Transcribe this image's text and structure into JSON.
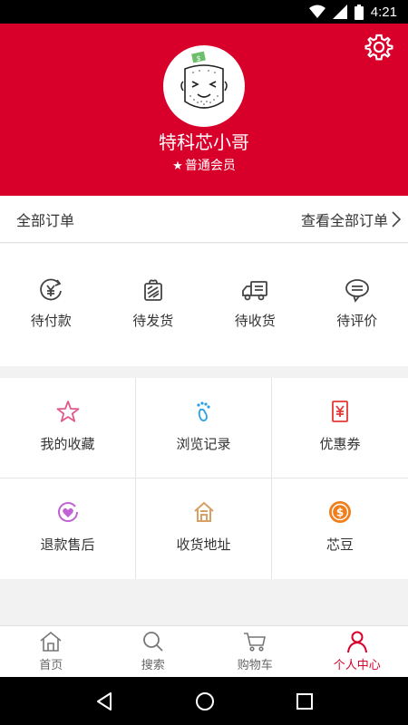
{
  "status_bar": {
    "time": "4:21"
  },
  "profile": {
    "username": "特科芯小哥",
    "member_star": "★",
    "member_level": "普通会员",
    "avatar_badge_text": "$"
  },
  "orders": {
    "title": "全部订单",
    "view_all": "查看全部订单"
  },
  "order_status": [
    {
      "label": "待付款",
      "icon": "yen-refresh-icon"
    },
    {
      "label": "待发货",
      "icon": "package-icon"
    },
    {
      "label": "待收货",
      "icon": "truck-icon"
    },
    {
      "label": "待评价",
      "icon": "comment-icon"
    }
  ],
  "services": [
    {
      "label": "我的收藏",
      "icon": "star-icon",
      "color": "#e05a8e"
    },
    {
      "label": "浏览记录",
      "icon": "footprint-icon",
      "color": "#2aa0e6"
    },
    {
      "label": "优惠券",
      "icon": "coupon-icon",
      "color": "#e53935"
    },
    {
      "label": "退款售后",
      "icon": "heart-circle-icon",
      "color": "#c162d6"
    },
    {
      "label": "收货地址",
      "icon": "home-icon",
      "color": "#d9a066"
    },
    {
      "label": "芯豆",
      "icon": "coin-icon",
      "color": "#f07e1c"
    }
  ],
  "tabs": [
    {
      "label": "首页",
      "icon": "home-tab-icon",
      "active": false
    },
    {
      "label": "搜索",
      "icon": "search-icon",
      "active": false
    },
    {
      "label": "购物车",
      "icon": "cart-icon",
      "active": false
    },
    {
      "label": "个人中心",
      "icon": "person-icon",
      "active": true
    }
  ],
  "colors": {
    "brand_red": "#d8002b",
    "text": "#333333",
    "inactive_tab": "#666666",
    "background": "#f2f2f2"
  }
}
